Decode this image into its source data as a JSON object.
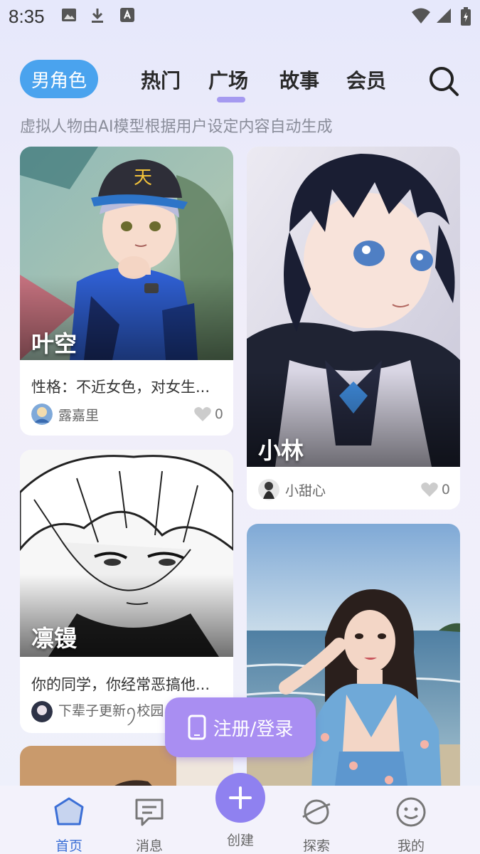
{
  "status": {
    "time": "8:35"
  },
  "top_nav": {
    "gender": "男角色",
    "tabs": [
      {
        "label": "热门",
        "active": false
      },
      {
        "label": "广场",
        "active": true
      },
      {
        "label": "故事",
        "active": false
      },
      {
        "label": "会员",
        "active": false
      }
    ]
  },
  "notice": "虚拟人物由AI模型根据用户设定内容自动生成",
  "cards": [
    {
      "name": "叶空",
      "desc": "性格：不近女色，对女生...",
      "author": "露嘉里",
      "likes": "0"
    },
    {
      "name": "小林",
      "desc": "",
      "author": "小甜心",
      "likes": "0"
    },
    {
      "name": "凛镘",
      "desc": "你的同学，你经常恶搞他...",
      "author": "下辈子更新ꪆ校园",
      "likes": ""
    },
    {
      "name": "",
      "desc": "",
      "author": "",
      "likes": ""
    }
  ],
  "login_button": "注册/登录",
  "bottom_nav": {
    "home": "首页",
    "messages": "消息",
    "create": "创建",
    "explore": "探索",
    "mine": "我的"
  },
  "colors": {
    "accent": "#8f81f0",
    "chip": "#4aa3ee",
    "home_active": "#3b6fd6",
    "login": "#a98ef2"
  }
}
